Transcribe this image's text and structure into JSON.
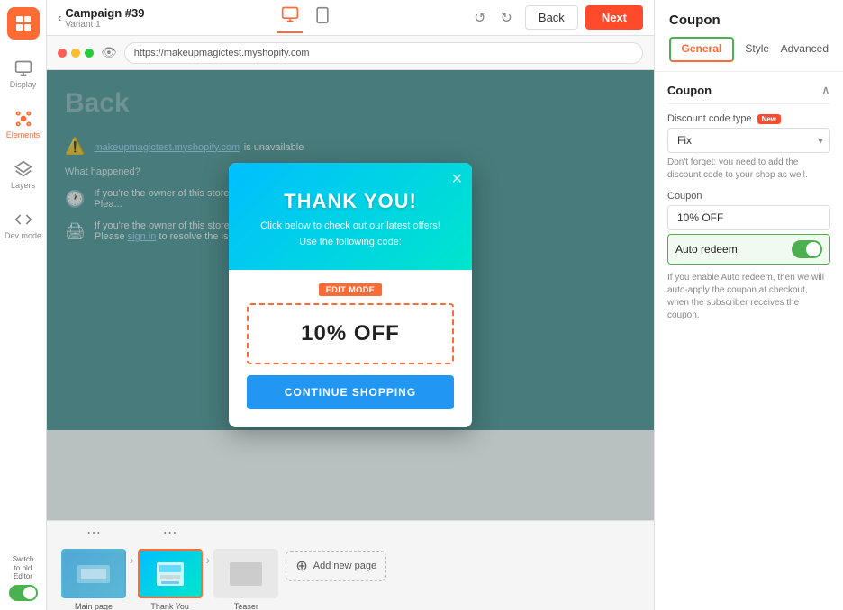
{
  "topbar": {
    "back_arrow": "‹",
    "campaign_title": "Campaign #39",
    "campaign_subtitle": "Variant 1",
    "next_label": "Next",
    "back_label": "Back",
    "undo": "↺",
    "redo": "↻"
  },
  "browser": {
    "url": "https://makeupmagictest.myshopify.com"
  },
  "popup": {
    "title": "THANK YOU!",
    "subtitle": "Click below to check out our latest offers!",
    "instruction": "Use the following code:",
    "edit_mode": "EDIT MODE",
    "coupon_code": "10% OFF",
    "cta_button": "CONTINUE SHOPPING",
    "close_x": "✕"
  },
  "panel": {
    "title": "Coupon",
    "tabs": [
      {
        "label": "General",
        "active": true
      },
      {
        "label": "Style",
        "active": false
      },
      {
        "label": "Advanced",
        "active": false
      }
    ],
    "coupon_section": {
      "title": "Coupon",
      "discount_code_type_label": "Discount code type",
      "new_badge": "New",
      "select_options": [
        "Fix"
      ],
      "selected_value": "Fix",
      "note": "Don't forget: you need to add the discount code to your shop as well.",
      "coupon_label": "Coupon",
      "coupon_value": "10% OFF",
      "auto_redeem_label": "Auto redeem",
      "auto_redeem_note": "If you enable Auto redeem, then we will auto-apply the coupon at checkout, when the subscriber receives the coupon."
    }
  },
  "pages": [
    {
      "label": "Main page",
      "active": false
    },
    {
      "label": "Thank You",
      "active": true
    },
    {
      "label": "Teaser",
      "active": false
    }
  ],
  "add_page_label": "Add new page",
  "sidebar": {
    "items": [
      {
        "label": "Display",
        "icon": "display"
      },
      {
        "label": "Elements",
        "icon": "elements"
      },
      {
        "label": "Layers",
        "icon": "layers"
      },
      {
        "label": "Dev mode",
        "icon": "dev"
      }
    ],
    "switch_label": "Switch\nto old\nEditor"
  }
}
